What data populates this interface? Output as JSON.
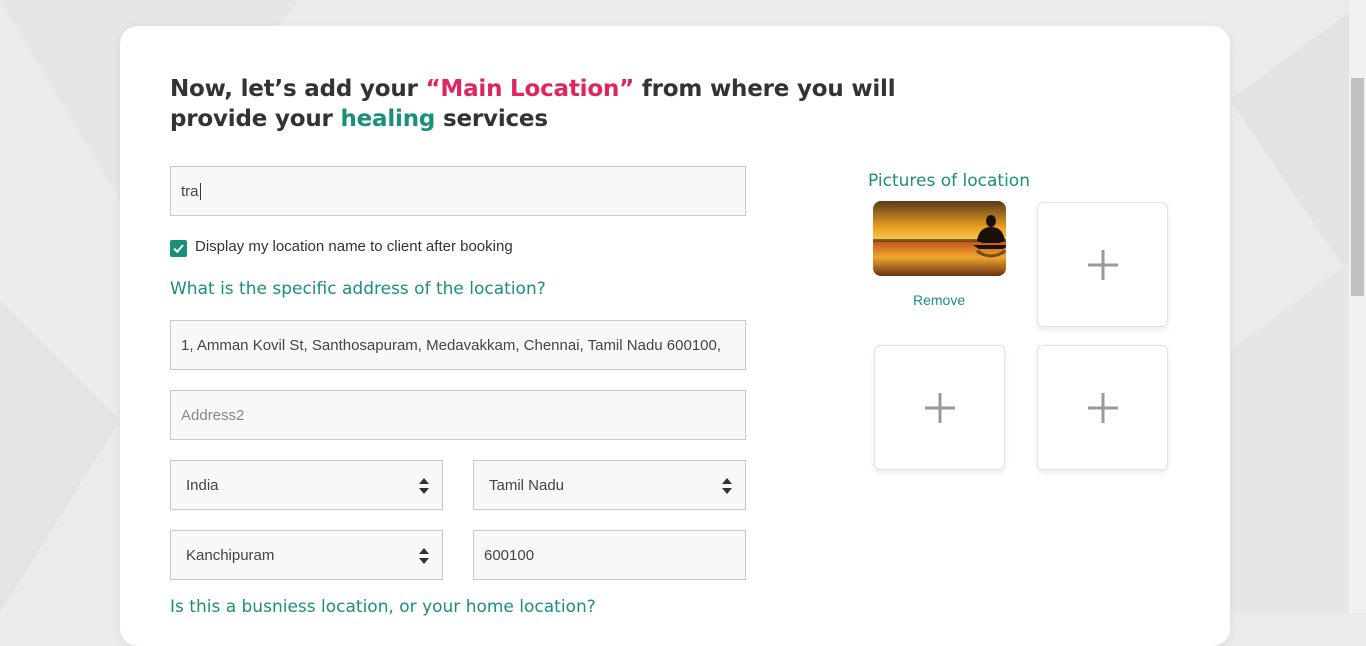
{
  "heading": {
    "part1": "Now, let’s add your ",
    "highlight1": "“Main Location”",
    "part2": " from where you will provide your ",
    "highlight2": "healing",
    "part3": " services"
  },
  "location_name": {
    "value": "tra"
  },
  "display_checkbox": {
    "checked": true,
    "label": "Display my location name to client after booking"
  },
  "address_question": "What is the specific address of the location?",
  "address1": {
    "value": "1, Amman Kovil St, Santhosapuram, Medavakkam, Chennai, Tamil Nadu 600100,"
  },
  "address2": {
    "placeholder": "Address2"
  },
  "country": {
    "value": "India"
  },
  "state": {
    "value": "Tamil Nadu"
  },
  "city": {
    "value": "Kanchipuram"
  },
  "zip": {
    "value": "600100"
  },
  "location_type_question": "Is this a busniess location, or your home location?",
  "pictures": {
    "title": "Pictures of location",
    "remove_label": "Remove",
    "add_icon": "plus-icon"
  },
  "colors": {
    "accent_pink": "#e0245e",
    "accent_teal": "#1a8f7a"
  }
}
